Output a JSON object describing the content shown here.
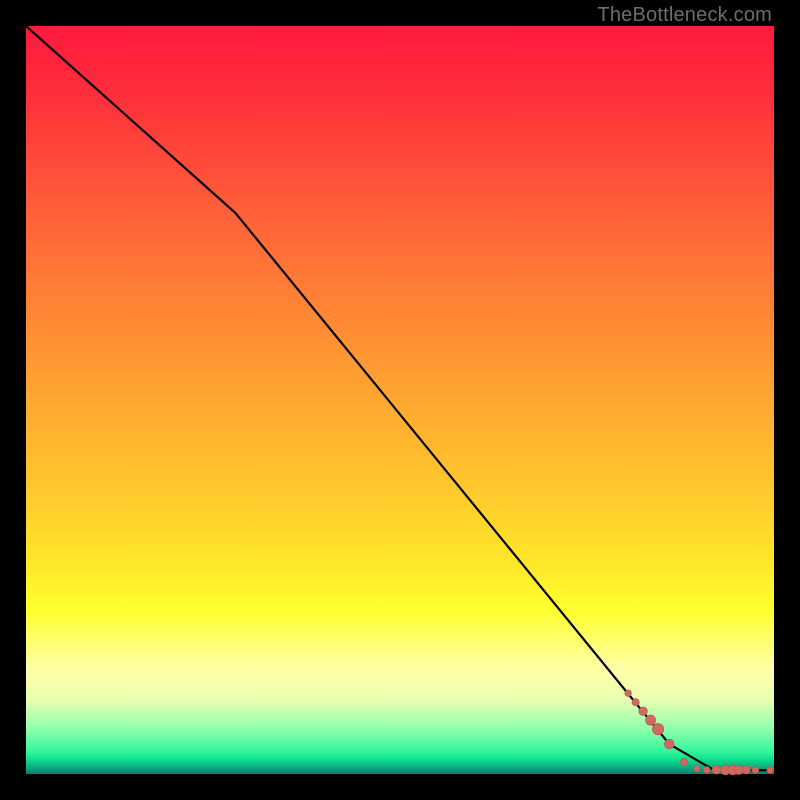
{
  "watermark": "TheBottleneck.com",
  "colors": {
    "curve": "#000000",
    "marker_fill": "#d06a60",
    "marker_stroke": "#b85a50"
  },
  "chart_data": {
    "type": "line",
    "title": "",
    "xlabel": "",
    "ylabel": "",
    "xlim": [
      0,
      100
    ],
    "ylim": [
      0,
      100
    ],
    "grid": false,
    "curve": {
      "x": [
        0,
        28,
        86,
        92,
        100
      ],
      "y": [
        100,
        75,
        4,
        0.5,
        0.5
      ]
    },
    "markers": {
      "x": [
        80.5,
        81.5,
        82.5,
        83.5,
        84.5,
        86,
        88,
        89.7,
        91,
        92.3,
        93.5,
        94.5,
        95.3,
        96.3,
        97.5,
        99.5
      ],
      "y": [
        10.8,
        9.6,
        8.4,
        7.2,
        6.0,
        4.0,
        1.6,
        0.7,
        0.55,
        0.55,
        0.55,
        0.55,
        0.55,
        0.55,
        0.55,
        0.55
      ],
      "r": [
        3.2,
        3.6,
        4.2,
        5.0,
        5.6,
        4.8,
        3.6,
        3.0,
        3.4,
        4.2,
        4.8,
        5.0,
        4.6,
        4.0,
        3.4,
        3.4
      ]
    }
  }
}
